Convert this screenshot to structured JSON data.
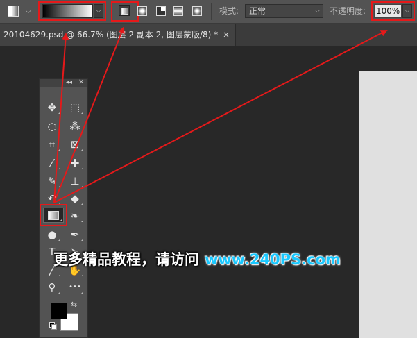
{
  "optionsBar": {
    "mode_label": "模式:",
    "mode_value": "正常",
    "opacity_label": "不透明度:",
    "opacity_value": "100%"
  },
  "document": {
    "tab_title": "20104629.psd @ 66.7% (图层 2 副本 2, 图层蒙版/8) *",
    "close_glyph": "×"
  },
  "toolsPanel": {
    "collapse_glyph": "◂◂",
    "close_glyph": "✕",
    "tools": [
      {
        "name": "move",
        "icon": "move-icon",
        "glyph": "✥"
      },
      {
        "name": "marquee",
        "icon": "rect-marquee-icon",
        "glyph": "⬚"
      },
      {
        "name": "lasso",
        "icon": "lasso-icon",
        "glyph": "◌"
      },
      {
        "name": "magic-wand",
        "icon": "magic-wand-icon",
        "glyph": "⁂"
      },
      {
        "name": "crop",
        "icon": "crop-icon",
        "glyph": "⌗"
      },
      {
        "name": "frame",
        "icon": "frame-icon",
        "glyph": "⊠"
      },
      {
        "name": "eyedropper",
        "icon": "eyedropper-icon",
        "glyph": "⁄"
      },
      {
        "name": "healing",
        "icon": "bandage-icon",
        "glyph": "✚"
      },
      {
        "name": "brush",
        "icon": "brush-icon",
        "glyph": "✎"
      },
      {
        "name": "stamp",
        "icon": "stamp-icon",
        "glyph": "⊥"
      },
      {
        "name": "history-brush",
        "icon": "history-brush-icon",
        "glyph": "↶"
      },
      {
        "name": "eraser",
        "icon": "eraser-icon",
        "glyph": "◆"
      },
      {
        "name": "gradient",
        "icon": "gradient-icon",
        "glyph": ""
      },
      {
        "name": "blur",
        "icon": "blur-icon",
        "glyph": "❧"
      },
      {
        "name": "dodge",
        "icon": "dodge-icon",
        "glyph": "●"
      },
      {
        "name": "pen",
        "icon": "pen-icon",
        "glyph": "✒"
      },
      {
        "name": "type",
        "icon": "type-icon",
        "glyph": "T"
      },
      {
        "name": "path-select",
        "icon": "path-select-icon",
        "glyph": "➤"
      },
      {
        "name": "line",
        "icon": "line-icon",
        "glyph": "╱"
      },
      {
        "name": "hand",
        "icon": "hand-icon",
        "glyph": "✋"
      },
      {
        "name": "zoom",
        "icon": "zoom-icon",
        "glyph": "⚲"
      },
      {
        "name": "more",
        "icon": "more-icon",
        "glyph": "•••"
      }
    ],
    "swap_glyph": "⇆",
    "foreground_color": "#000000",
    "background_color": "#ffffff"
  },
  "watermark": {
    "text": "更多精品教程，请访问",
    "url": "www.240PS.com"
  },
  "colors": {
    "highlight_red": "#e5191a",
    "panel_bg": "#535353",
    "canvas_bg": "#282828"
  }
}
